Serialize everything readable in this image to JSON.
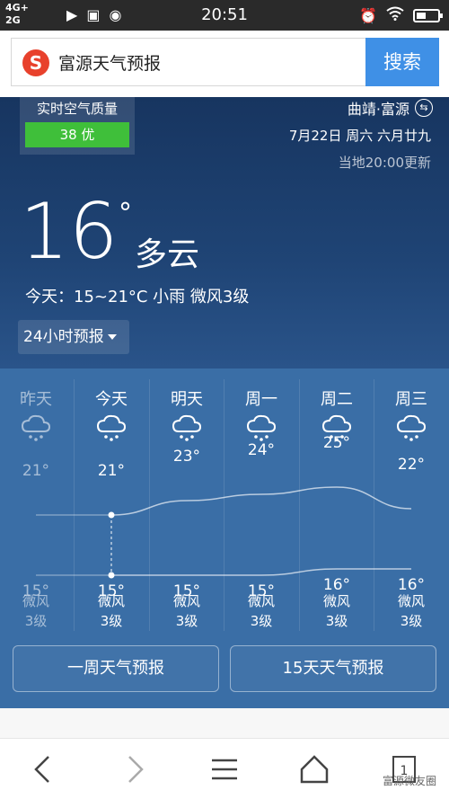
{
  "status_bar": {
    "network_top": "4G+",
    "network_bottom": "2G",
    "time": "20:51"
  },
  "search": {
    "query": "富源天气预报",
    "button_label": "搜索",
    "logo_letter": "S"
  },
  "weather": {
    "aqi_title": "实时空气质量",
    "aqi_value": "38 优",
    "location": "曲靖·富源",
    "date": "7月22日 周六 六月廿九",
    "updated": "当地20:00更新",
    "current_temp": "16",
    "degree_symbol": "°",
    "condition": "多云",
    "today_summary": "今天：15~21°C 小雨 微风3级",
    "forecast_toggle": "24小时预报"
  },
  "forecast": {
    "days": [
      {
        "name": "昨天",
        "high": "21°",
        "low": "15°",
        "wind": "微风",
        "level": "3级",
        "past": true
      },
      {
        "name": "今天",
        "high": "21°",
        "low": "15°",
        "wind": "微风",
        "level": "3级",
        "past": false
      },
      {
        "name": "明天",
        "high": "23°",
        "low": "15°",
        "wind": "微风",
        "level": "3级",
        "past": false
      },
      {
        "name": "周一",
        "high": "24°",
        "low": "15°",
        "wind": "微风",
        "level": "3级",
        "past": false
      },
      {
        "name": "周二",
        "high": "25°",
        "low": "16°",
        "wind": "微风",
        "level": "3级",
        "past": false
      },
      {
        "name": "周三",
        "high": "22°",
        "low": "16°",
        "wind": "微风",
        "level": "3级",
        "past": false
      }
    ],
    "week_button": "一周天气预报",
    "fifteen_button": "15天天气预报"
  },
  "watermark": "富源微友圈",
  "colors": {
    "search_button": "#3f90e6",
    "aqi_good": "#3fbf3a",
    "panel": "#3a6ea6"
  }
}
